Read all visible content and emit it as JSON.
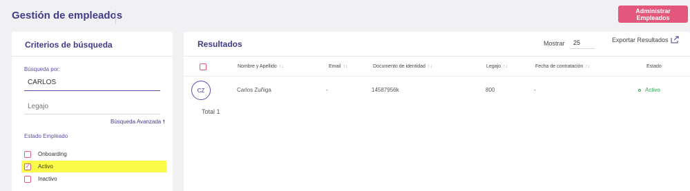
{
  "header": {
    "title": "Gestión de empleados",
    "admin_button": "Administrar Empleados"
  },
  "colors": {
    "accent": "#3f3a8a",
    "primary_button": "#e2577a",
    "highlight": "#fbfb4a",
    "status_active": "#3aa35a"
  },
  "search_panel": {
    "title": "Criterios de búsqueda",
    "search_label": "Búsqueda por:",
    "search_value": "CARLOS",
    "legajo_placeholder": "Legajo",
    "advanced_link": "Búsqueda Avanzada",
    "advanced_icon": "arrow-up-icon",
    "estado_label": "Estado Empleado",
    "estados": [
      {
        "label": "Onboarding",
        "checked": false
      },
      {
        "label": "Activo",
        "checked": true,
        "highlighted": true
      },
      {
        "label": "Inactivo",
        "checked": false
      }
    ]
  },
  "results_panel": {
    "title": "Resultados",
    "mostrar_label": "Mostrar",
    "mostrar_value": "25",
    "export_label": "Exportar Resultados",
    "export_icon": "export-icon",
    "columns": [
      "Nombre y Apellido",
      "Email",
      "Documento de identidad",
      "Legajo",
      "Fecha de contratación",
      "Estado"
    ],
    "rows": [
      {
        "initials": "CZ",
        "name": "Carlos Zuñiga",
        "email": "-",
        "documento": "14587956k",
        "legajo": "800",
        "fecha": "-",
        "estado": "Activo"
      }
    ],
    "total": "Total 1"
  }
}
